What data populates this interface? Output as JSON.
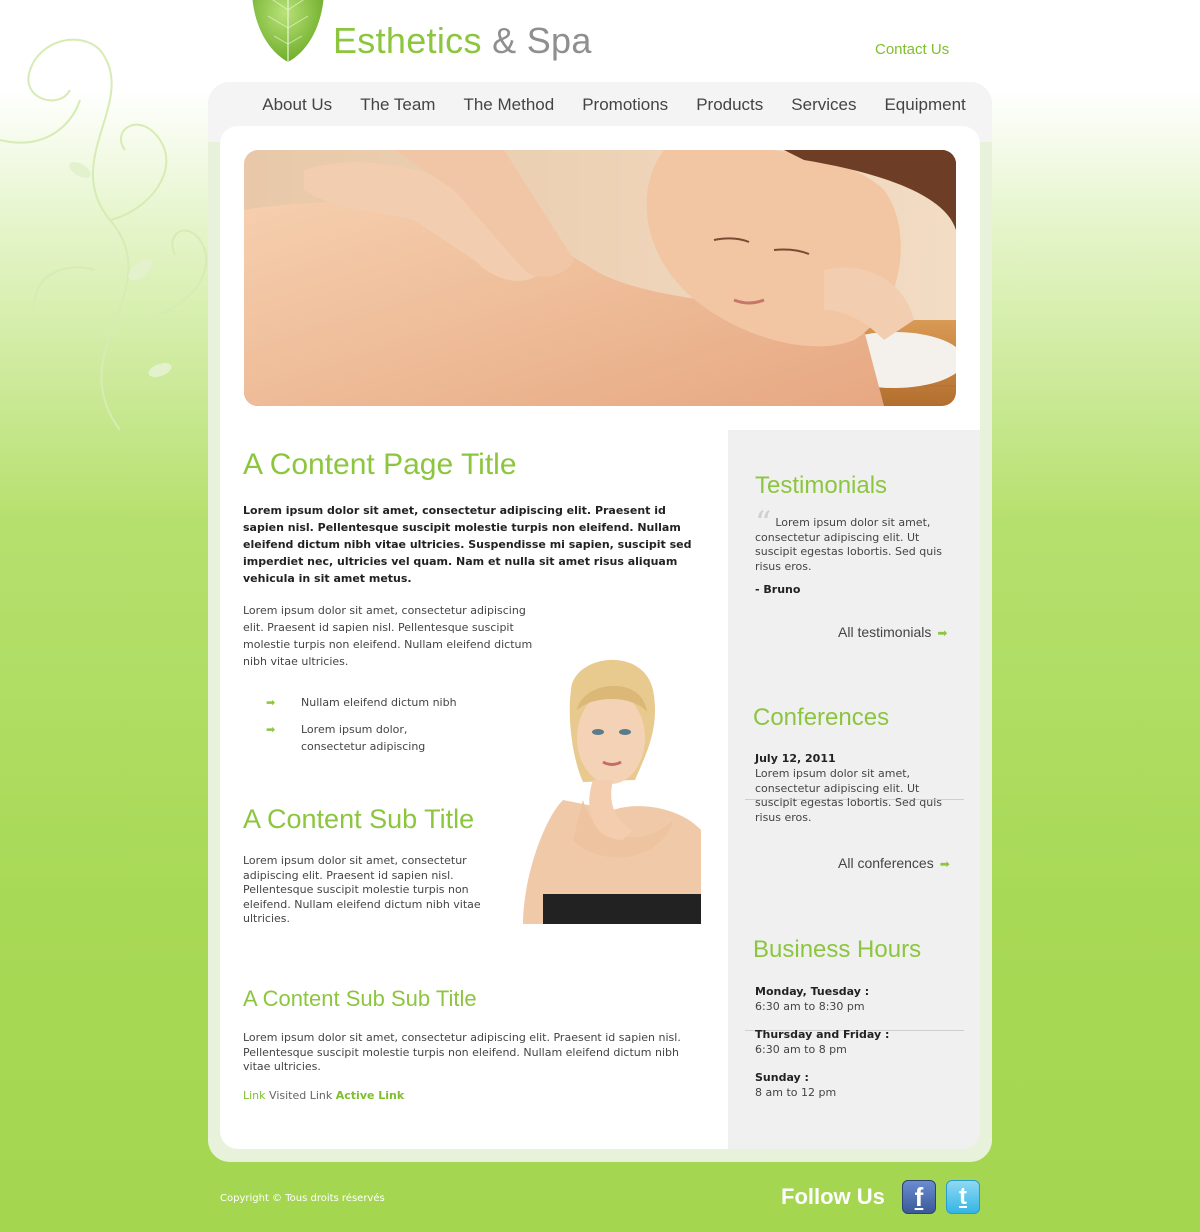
{
  "header": {
    "brand_primary": "Esthetics",
    "brand_amp": "&",
    "brand_secondary": "Spa",
    "contact_label": "Contact Us"
  },
  "nav": {
    "items": [
      "About Us",
      "The Team",
      "The Method",
      "Promotions",
      "Products",
      "Services",
      "Equipment"
    ]
  },
  "main": {
    "title": "A Content Page Title",
    "lead": "Lorem ipsum dolor sit amet, consectetur adipiscing elit. Praesent id sapien nisl. Pellentesque suscipit molestie turpis non eleifend. Nullam eleifend dictum nibh vitae ultricies. Suspendisse mi sapien, suscipit sed imperdiet nec, ultricies vel quam. Nam et nulla sit amet risus aliquam vehicula in sit amet metus.",
    "para1": "Lorem ipsum dolor sit amet, consectetur adipiscing elit. Praesent id sapien nisl. Pellentesque suscipit molestie turpis non eleifend. Nullam eleifend dictum nibh vitae ultricies.",
    "bullets": [
      "Nullam eleifend dictum nibh",
      "Lorem ipsum dolor, consectetur adipiscing"
    ],
    "subtitle": "A Content Sub Title",
    "para2": "Lorem ipsum dolor sit amet, consectetur adipiscing elit. Praesent id sapien nisl. Pellentesque suscipit molestie turpis non eleifend. Nullam eleifend dictum nibh vitae ultricies.",
    "subsubtitle": "A Content Sub Sub Title",
    "para3": "Lorem ipsum dolor sit amet, consectetur adipiscing elit. Praesent id sapien nisl. Pellentesque suscipit molestie turpis non eleifend. Nullam eleifend dictum nibh vitae ultricies.",
    "link_label": "Link",
    "visited_link_label": "Visited Link",
    "active_link_label": "Active Link"
  },
  "sidebar": {
    "testimonials_title": "Testimonials",
    "testimonial_quote": "Lorem ipsum dolor sit amet, consectetur adipiscing elit. Ut suscipit egestas lobortis. Sed quis risus eros.",
    "testimonial_author": "- Bruno",
    "all_testimonials": "All testimonials",
    "conferences_title": "Conferences",
    "conference_date": "July 12, 2011",
    "conference_text": "Lorem ipsum dolor sit amet, consectetur adipiscing elit. Ut suscipit egestas lobortis. Sed quis risus eros.",
    "all_conferences": "All conferences",
    "hours_title": "Business Hours",
    "hours": [
      {
        "days": "Monday, Tuesday :",
        "time": "6:30 am to 8:30 pm"
      },
      {
        "days": "Thursday and Friday :",
        "time": "6:30 am to 8 pm"
      },
      {
        "days": "Sunday :",
        "time": "8 am to 12 pm"
      }
    ]
  },
  "footer": {
    "copyright": "Copyright © Tous droits réservés",
    "follow_us": "Follow Us",
    "facebook_icon": "facebook-icon",
    "twitter_icon": "twitter-icon"
  },
  "colors": {
    "accent_green": "#8cc63e",
    "background_green": "#a8d956",
    "sidebar_gray": "#f0f0f0"
  }
}
